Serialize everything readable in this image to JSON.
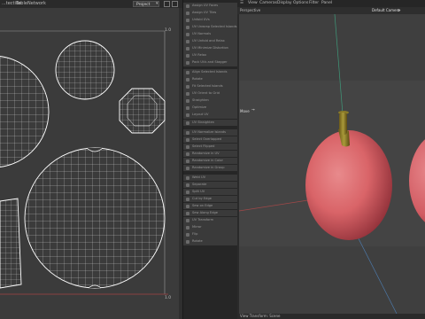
{
  "uv_editor": {
    "menu": [
      "...tection",
      "Table",
      "Network"
    ],
    "projection_value": "Project",
    "label_top_right": "1.0",
    "label_bottom_right": "1.0"
  },
  "command_palette": {
    "items": [
      "Assign UV Faces",
      "Assign UV Tiles",
      "Unfold UVs",
      "UV Unwrap Selected Islands",
      "UV Normals",
      "UV Unfold and Relax",
      "UV Minimize Distortion",
      "UV Relax",
      "Pack UVs and Stagger",
      "Align Selected Islands",
      "Rotate",
      "Fit Selected Islands",
      "UV Orient to Grid",
      "Straighten",
      "Optimize",
      "Layout UV",
      "UV Straighten",
      "UV Normalize Islands",
      "Select Overlapped",
      "Select Flipped",
      "Randomize in UV",
      "Randomize in Color",
      "Randomize in Group",
      "Weld UV",
      "Separate",
      "Split UV",
      "Cut by Edge",
      "Sew on Edge",
      "Sew Along Edge",
      "UV Transform",
      "Mirror",
      "Flip",
      "Rotate"
    ]
  },
  "viewport": {
    "menu": [
      "View",
      "Cameras",
      "Display",
      "Options",
      "Filter",
      "Panel"
    ],
    "perspective_label": "Perspective",
    "camera_label": "Default Camera",
    "move_label": "Move",
    "bottom_label": "View Transform: Scene"
  }
}
